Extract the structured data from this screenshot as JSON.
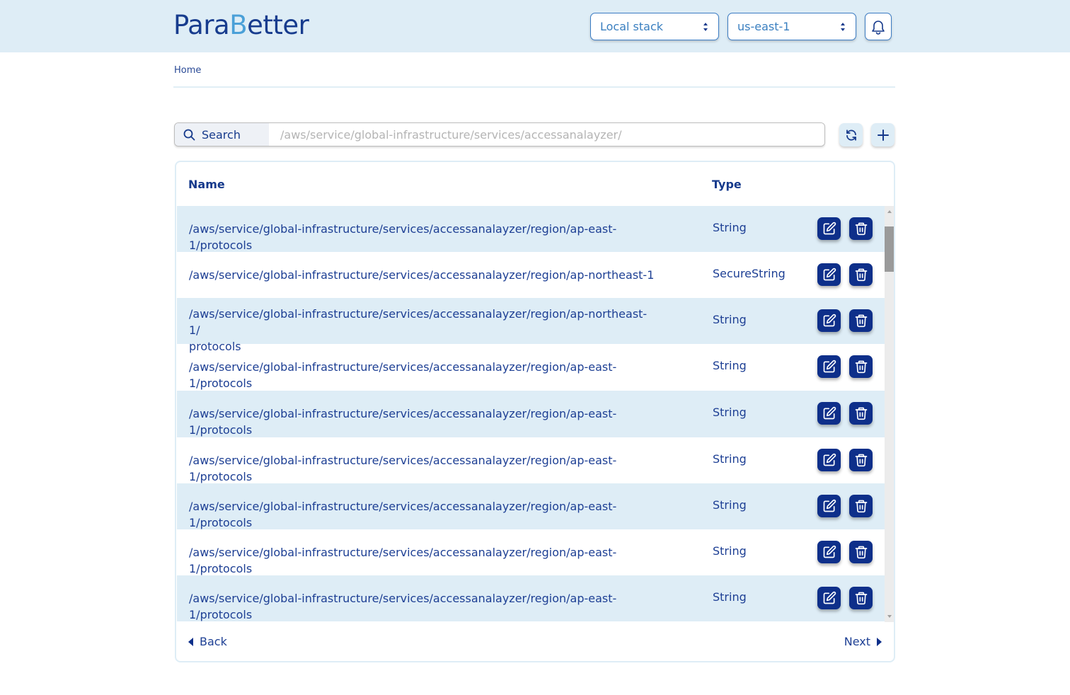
{
  "app": {
    "logo_text_a": "Para",
    "logo_text_b": "B",
    "logo_text_c": "ett",
    "logo_text_d": "er",
    "brand_color": "#173c8e",
    "accent_color": "#4aa0d8"
  },
  "header": {
    "stack_select": {
      "value": "Local stack"
    },
    "region_select": {
      "value": "us-east-1"
    },
    "notifications_icon": "bell-icon"
  },
  "breadcrumb": {
    "home": "Home"
  },
  "search": {
    "label": "Search",
    "icon": "search-icon",
    "value": "",
    "placeholder": "/aws/service/global-infrastructure/services/accessanalayzer/"
  },
  "toolbar": {
    "refresh_icon": "refresh-icon",
    "add_icon": "plus-icon"
  },
  "table": {
    "columns": {
      "name": "Name",
      "type": "Type"
    },
    "rows": [
      {
        "name": "/aws/service/global-infrastructure/services/accessanalayzer/region/ap-east-1/protocols",
        "type": "String"
      },
      {
        "name": "/aws/service/global-infrastructure/services/accessanalayzer/region/ap-northeast-1",
        "type": "SecureString"
      },
      {
        "name": "/aws/service/global-infrastructure/services/accessanalayzer/region/ap-northeast-1/ protocols",
        "type": "String"
      },
      {
        "name": "/aws/service/global-infrastructure/services/accessanalayzer/region/ap-east-1/protocols",
        "type": "String"
      },
      {
        "name": "/aws/service/global-infrastructure/services/accessanalayzer/region/ap-east-1/protocols",
        "type": "String"
      },
      {
        "name": "/aws/service/global-infrastructure/services/accessanalayzer/region/ap-east-1/protocols",
        "type": "String"
      },
      {
        "name": "/aws/service/global-infrastructure/services/accessanalayzer/region/ap-east-1/protocols",
        "type": "String"
      },
      {
        "name": "/aws/service/global-infrastructure/services/accessanalayzer/region/ap-east-1/protocols",
        "type": "String"
      },
      {
        "name": "/aws/service/global-infrastructure/services/accessanalayzer/region/ap-east-1/protocols",
        "type": "String"
      }
    ],
    "row_actions": {
      "edit_icon": "edit-icon",
      "delete_icon": "trash-icon"
    }
  },
  "pagination": {
    "back": "Back",
    "next": "Next"
  }
}
